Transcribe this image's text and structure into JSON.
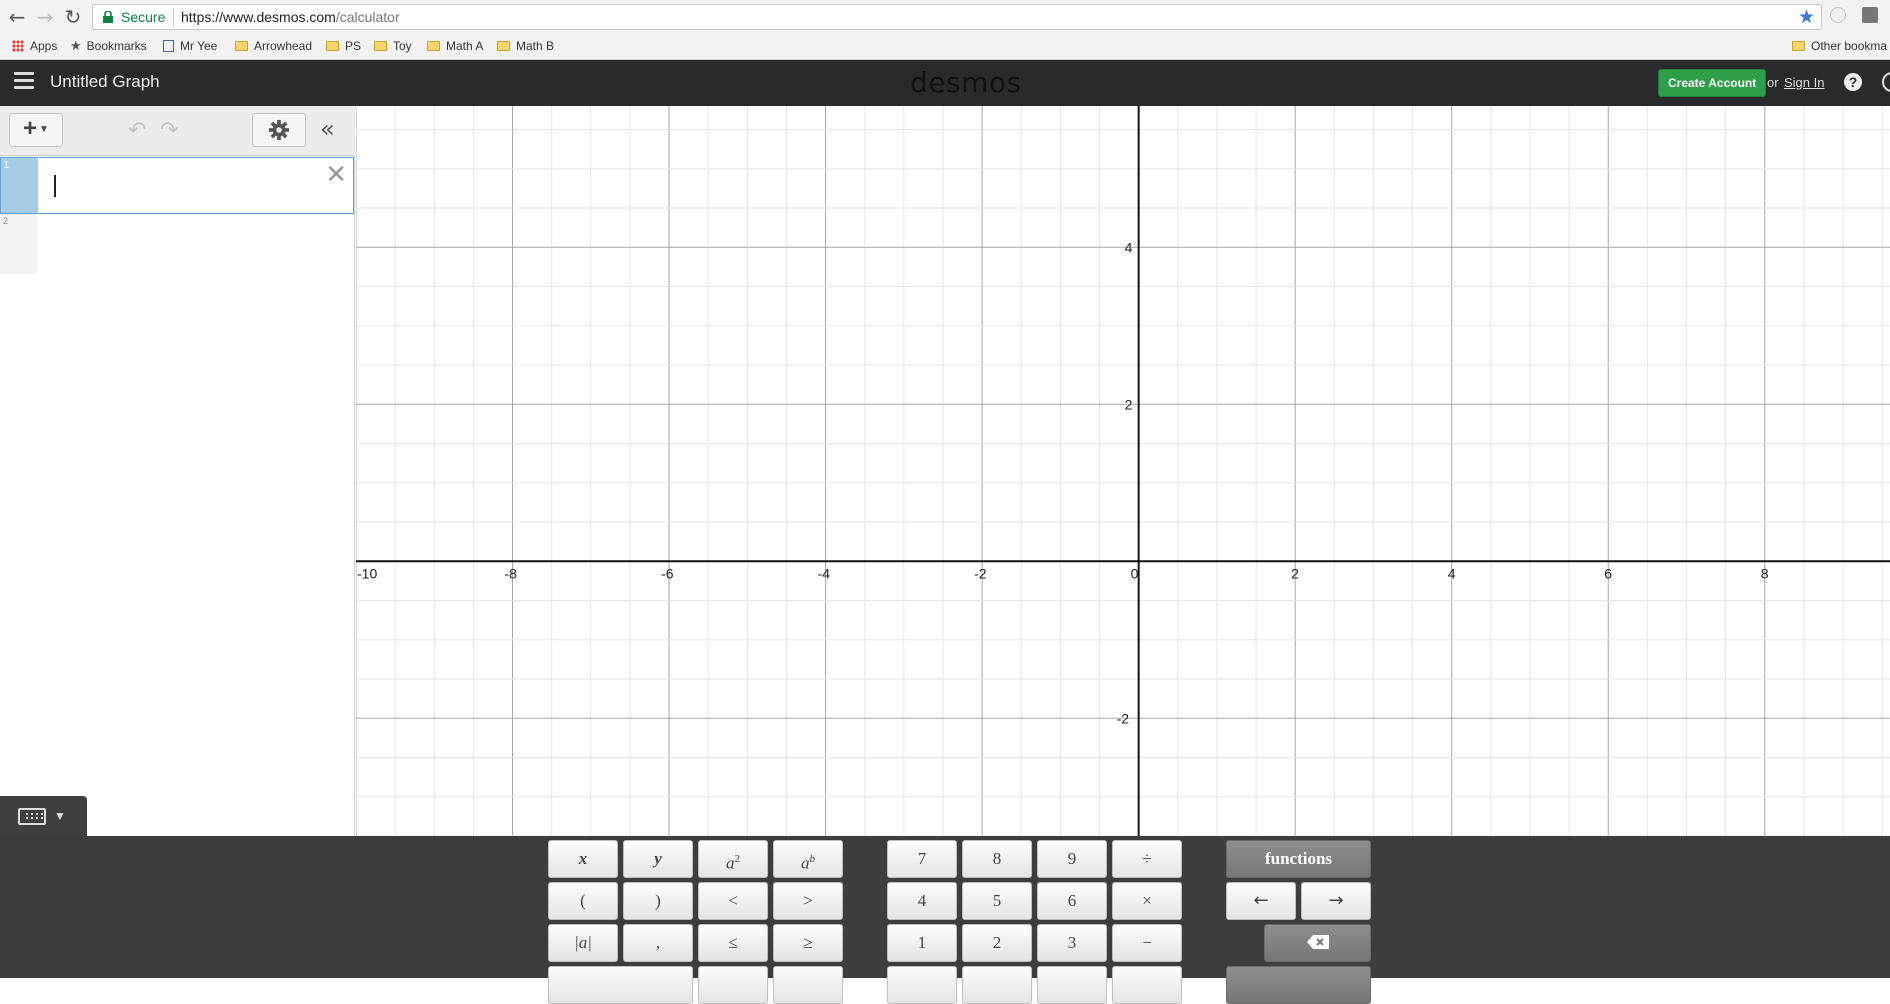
{
  "browser": {
    "secure_label": "Secure",
    "url_host": "https://www.desmos.com",
    "url_path": "/calculator",
    "bookmarks": [
      "Apps",
      "Bookmarks",
      "Mr Yee",
      "Arrowhead",
      "PS",
      "Toy",
      "Math A",
      "Math B"
    ],
    "other_bookmarks": "Other bookma"
  },
  "header": {
    "graph_title": "Untitled Graph",
    "brand": "desmos",
    "create_account": "Create Account",
    "or": "or",
    "sign_in": "Sign In",
    "help": "?"
  },
  "expressions": {
    "rows": [
      {
        "number": "1",
        "value": ""
      },
      {
        "number": "2",
        "value": ""
      }
    ]
  },
  "graph": {
    "x_ticks": [
      "-10",
      "-8",
      "-6",
      "-4",
      "-2",
      "0",
      "2",
      "4",
      "6",
      "8"
    ],
    "y_ticks": [
      "4",
      "2",
      "-2"
    ],
    "x_range": [
      -10,
      9.6
    ],
    "y_range": [
      -3.5,
      5.8
    ],
    "major_step": 2,
    "minor_step": 0.5
  },
  "keypad": {
    "row1": [
      "x",
      "y",
      "a",
      "a",
      "7",
      "8",
      "9",
      "÷",
      "functions"
    ],
    "row2": [
      "(",
      ")",
      "<",
      ">",
      "4",
      "5",
      "6",
      "×",
      "←",
      "→"
    ],
    "row3": [
      "|a|",
      ",",
      "≤",
      "≥",
      "1",
      "2",
      "3",
      "−"
    ],
    "sup_2": "2",
    "sup_b": "b"
  }
}
